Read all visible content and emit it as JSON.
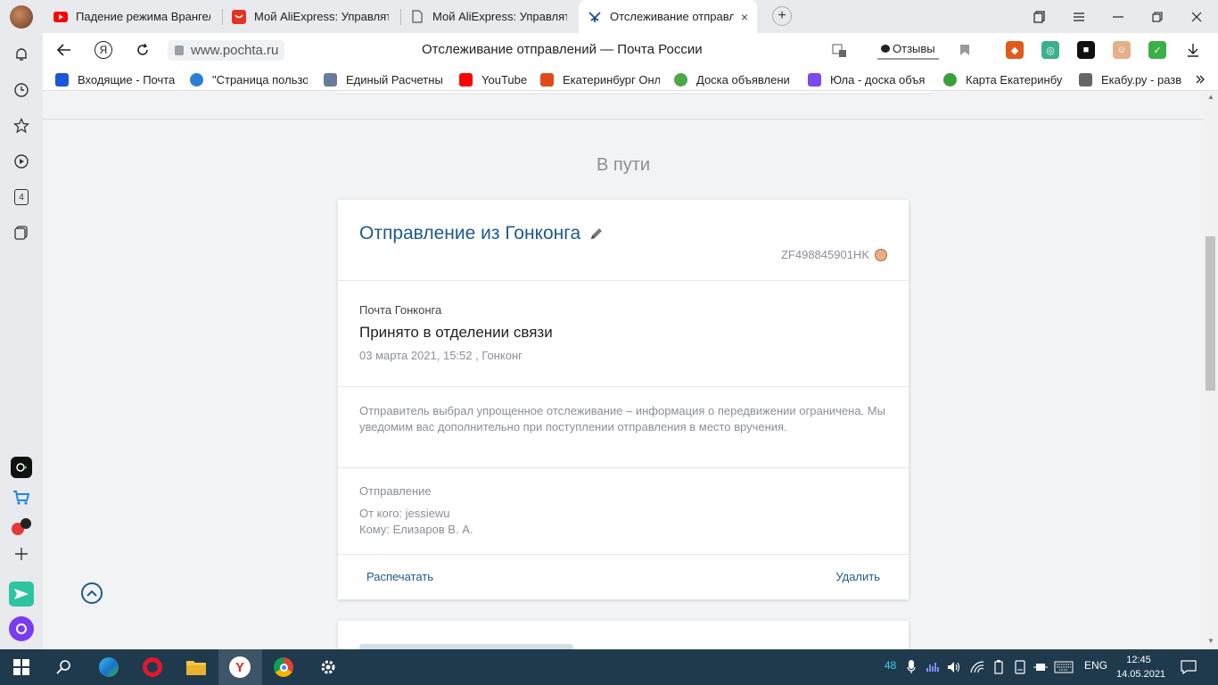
{
  "browser": {
    "tabs": [
      {
        "label": "Падение режима Врангел",
        "icon": "youtube-icon"
      },
      {
        "label": "Мой AliExpress: Управлять",
        "icon": "aliexpress-icon"
      },
      {
        "label": "Мой AliExpress: Управлять",
        "icon": "document-icon"
      },
      {
        "label": "Отслеживание отправл",
        "icon": "russian-post-icon"
      }
    ],
    "tab_close": "×",
    "new_tab": "+",
    "url": "www.pochta.ru",
    "page_title": "Отслеживание отправлений — Почта России",
    "reviews_label": "Отзывы",
    "yandex_label": "Я"
  },
  "bookmarks": [
    {
      "label": "Входящие - Почта",
      "color": "#1a56d6"
    },
    {
      "label": "\"Страница пользо",
      "color": "#2a7fd4"
    },
    {
      "label": "Единый Расчетны",
      "color": "#6a7a9a"
    },
    {
      "label": "YouTube",
      "color": "#ff0000"
    },
    {
      "label": "Екатеринбург Онл",
      "color": "#e04a1a"
    },
    {
      "label": "Доска объявлени",
      "color": "#4aa84a"
    },
    {
      "label": "Юла - доска объя",
      "color": "#7a4aee"
    },
    {
      "label": "Карта Екатеринбу",
      "color": "#3aa03a"
    },
    {
      "label": "Екабу.ру - разв",
      "color": "#666666"
    }
  ],
  "page": {
    "section_title": "В пути",
    "shipment": {
      "title": "Отправление из Гонконга",
      "track_number": "ZF498845901HK",
      "carrier": "Почта Гонконга",
      "status": "Принято в отделении связи",
      "datetime": "03 марта 2021, 15:52 , Гонконг",
      "notice": "Отправитель выбрал упрощенное отслеживание – информация о передвижении ограничена. Мы уведомим вас дополнительно при поступлении отправления в место вручения.",
      "section_label": "Отправление",
      "from": "От кого: jessiewu",
      "to": "Кому: Елизаров В. А.",
      "print_label": "Распечатать",
      "delete_label": "Удалить"
    }
  },
  "sidebar_badge": "4",
  "taskbar": {
    "tray_count": "48",
    "language": "ENG",
    "time": "12:45",
    "date": "14.05.2021"
  },
  "colors": {
    "link_blue": "#1d5a8a",
    "muted_gray": "#8a8f96",
    "taskbar": "#1f3a4d"
  }
}
